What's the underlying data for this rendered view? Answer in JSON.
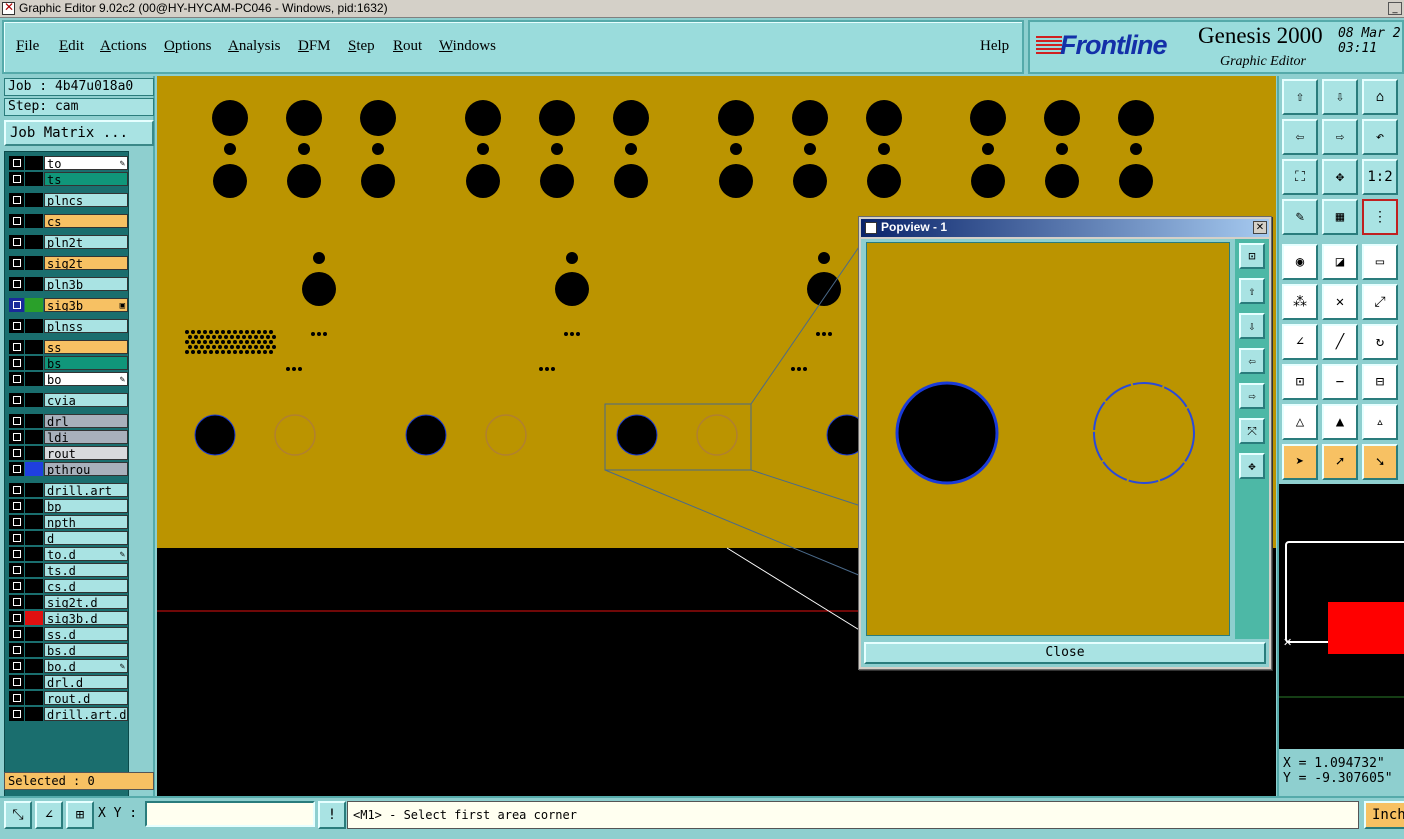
{
  "window": {
    "title": "Graphic Editor 9.02c2 (00@HY-HYCAM-PC046 - Windows, pid:1632)"
  },
  "menu": {
    "items": [
      {
        "label": "File",
        "underline": "F",
        "rest": "ile"
      },
      {
        "label": "Edit",
        "underline": "E",
        "rest": "dit"
      },
      {
        "label": "Actions",
        "underline": "A",
        "rest": "ctions"
      },
      {
        "label": "Options",
        "underline": "O",
        "rest": "ptions"
      },
      {
        "label": "Analysis",
        "underline": "A",
        "rest": "nalysis"
      },
      {
        "label": "DFM",
        "underline": "D",
        "rest": "FM"
      },
      {
        "label": "Step",
        "underline": "S",
        "rest": "tep"
      },
      {
        "label": "Rout",
        "underline": "R",
        "rest": "out"
      },
      {
        "label": "Windows",
        "underline": "W",
        "rest": "indows"
      }
    ],
    "help": "Help"
  },
  "brand": {
    "logo": "Frontline",
    "product": "Genesis 2000",
    "subtitle": "Graphic Editor",
    "date": "08 Mar 2",
    "time": "03:11 "
  },
  "left_panel": {
    "job": "Job : 4b47u018a0",
    "step": "Step: cam",
    "job_matrix_button": "Job Matrix ...",
    "selected": "Selected : 0",
    "layers": [
      {
        "name": "to",
        "color": "white",
        "swatch": "#000000",
        "mark": "✎"
      },
      {
        "name": "ts",
        "color": "green",
        "swatch": "#000000",
        "mark": ""
      },
      {
        "name": "plncs",
        "color": "cyan",
        "swatch": "#000000",
        "mark": ""
      },
      {
        "name": "cs",
        "color": "orange",
        "swatch": "#000000",
        "mark": ""
      },
      {
        "name": "pln2t",
        "color": "cyan",
        "swatch": "#000000",
        "mark": ""
      },
      {
        "name": "sig2t",
        "color": "orange",
        "swatch": "#000000",
        "mark": ""
      },
      {
        "name": "pln3b",
        "color": "cyan",
        "swatch": "#000000",
        "mark": ""
      },
      {
        "name": "sig3b",
        "color": "orange",
        "swatch": "#2aa02a",
        "mark": "▣",
        "checkbox": "#1a2a9a"
      },
      {
        "name": "plnss",
        "color": "cyan",
        "swatch": "#000000",
        "mark": ""
      },
      {
        "name": "ss",
        "color": "orange",
        "swatch": "#000000",
        "mark": ""
      },
      {
        "name": "bs",
        "color": "green",
        "swatch": "#000000",
        "mark": ""
      },
      {
        "name": "bo",
        "color": "white",
        "swatch": "#000000",
        "mark": "✎"
      },
      {
        "name": "cvia",
        "color": "cyan",
        "swatch": "#000000",
        "mark": ""
      },
      {
        "name": "drl",
        "color": "grey",
        "swatch": "#000000",
        "mark": ""
      },
      {
        "name": "ldi",
        "color": "grey",
        "swatch": "#000000",
        "mark": ""
      },
      {
        "name": "rout",
        "color": "lgrey",
        "swatch": "#000000",
        "mark": ""
      },
      {
        "name": "pthrou",
        "color": "grey",
        "swatch": "#1f3fe0",
        "mark": ""
      },
      {
        "name": "drill.art",
        "color": "cyan",
        "swatch": "#000000",
        "mark": ""
      },
      {
        "name": "bp",
        "color": "cyan",
        "swatch": "#000000",
        "mark": ""
      },
      {
        "name": "npth",
        "color": "cyan",
        "swatch": "#000000",
        "mark": ""
      },
      {
        "name": "d",
        "color": "cyan",
        "swatch": "#000000",
        "mark": ""
      },
      {
        "name": "to.d",
        "color": "cyan",
        "swatch": "#000000",
        "mark": "✎"
      },
      {
        "name": "ts.d",
        "color": "cyan",
        "swatch": "#000000",
        "mark": ""
      },
      {
        "name": "cs.d",
        "color": "cyan",
        "swatch": "#000000",
        "mark": ""
      },
      {
        "name": "sig2t.d",
        "color": "cyan",
        "swatch": "#000000",
        "mark": ""
      },
      {
        "name": "sig3b.d",
        "color": "cyan",
        "swatch": "#e01010",
        "mark": ""
      },
      {
        "name": "ss.d",
        "color": "cyan",
        "swatch": "#000000",
        "mark": ""
      },
      {
        "name": "bs.d",
        "color": "cyan",
        "swatch": "#000000",
        "mark": ""
      },
      {
        "name": "bo.d",
        "color": "cyan",
        "swatch": "#000000",
        "mark": "✎"
      },
      {
        "name": "drl.d",
        "color": "cyan",
        "swatch": "#000000",
        "mark": ""
      },
      {
        "name": "rout.d",
        "color": "cyan",
        "swatch": "#000000",
        "mark": ""
      },
      {
        "name": "drill.art.d",
        "color": "cyan",
        "swatch": "#000000",
        "mark": ""
      }
    ]
  },
  "canvas": {
    "board_color": "#bb9400",
    "background_color": "#000000",
    "hole_color": "#000000"
  },
  "popview": {
    "title": "Popview - 1",
    "close_button": "Close"
  },
  "right_panel": {
    "coord_x": "X = 1.094732\"",
    "coord_y": "Y = -9.307605\"",
    "scale_button": "1:2"
  },
  "status_bar": {
    "xy_label": "X Y :",
    "xy_value": "",
    "prompt": "<M1> - Select first area corner",
    "units_button": "Inch",
    "warn_button": "!"
  }
}
